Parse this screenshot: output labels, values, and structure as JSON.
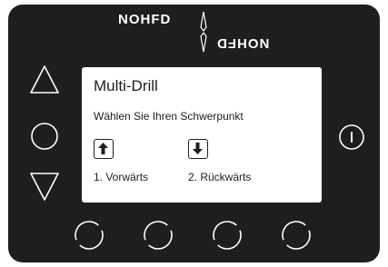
{
  "brand": {
    "logo_text": "NOHFD",
    "logo_text_mirrored": "NOHFD"
  },
  "screen": {
    "title": "Multi-Drill",
    "prompt": "Wählen Sie Ihren Schwerpunkt",
    "options": [
      {
        "icon": "arrow-up-icon",
        "label": "1. Vorwärts"
      },
      {
        "icon": "arrow-down-icon",
        "label": "2. Rückwärts"
      }
    ]
  },
  "hardware_buttons": {
    "left": [
      "triangle-up-button",
      "circle-button",
      "triangle-down-button"
    ],
    "right": [
      "power-button"
    ],
    "bottom": [
      "soft-button-1",
      "soft-button-2",
      "soft-button-3",
      "soft-button-4"
    ]
  },
  "colors": {
    "device": "#1e1e1e",
    "screen": "#ffffff",
    "ink": "#1e1e1e",
    "button_outline": "#ffffff"
  }
}
